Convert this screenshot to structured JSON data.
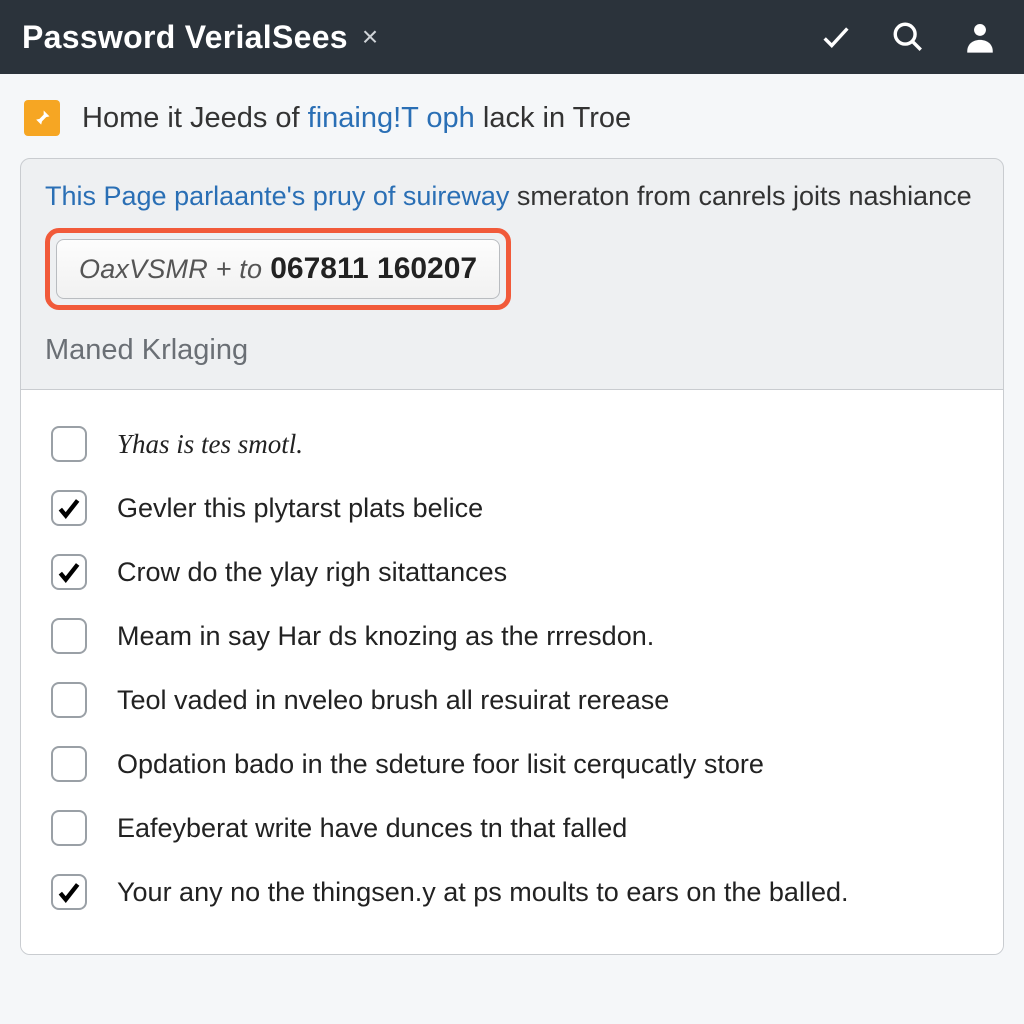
{
  "header": {
    "title": "Password VerialSees",
    "close_glyph": "×"
  },
  "breadcrumb": {
    "prefix": "Home it Jeeds of ",
    "link": "finaing!T oph",
    "suffix": " lack in Troe"
  },
  "card": {
    "desc_link": "This Page parlaante's pruy of suireway",
    "desc_rest": " smeraton from canrels joits nashiance",
    "code_label": "OaxVSMR + to",
    "code_value": "067811 160207",
    "section_label": "Maned Krlaging"
  },
  "items": [
    {
      "checked": false,
      "label": "Yhas is tes smotl."
    },
    {
      "checked": true,
      "label": "Gevler this plytarst plats belice"
    },
    {
      "checked": true,
      "label": "Crow do the ylay righ sitattances"
    },
    {
      "checked": false,
      "label": "Meam in say Har ds knozing as the rrresdon."
    },
    {
      "checked": false,
      "label": "Teol vaded in nveleo brush all resuirat rerease"
    },
    {
      "checked": false,
      "label": "Opdation bado in the sdeture foor lisit cerqucatly store"
    },
    {
      "checked": false,
      "label": "Eafeyberat write have dunces tn that falled"
    },
    {
      "checked": true,
      "label": "Your any no the thingsen.y at ps moults to ears on the balled."
    }
  ]
}
